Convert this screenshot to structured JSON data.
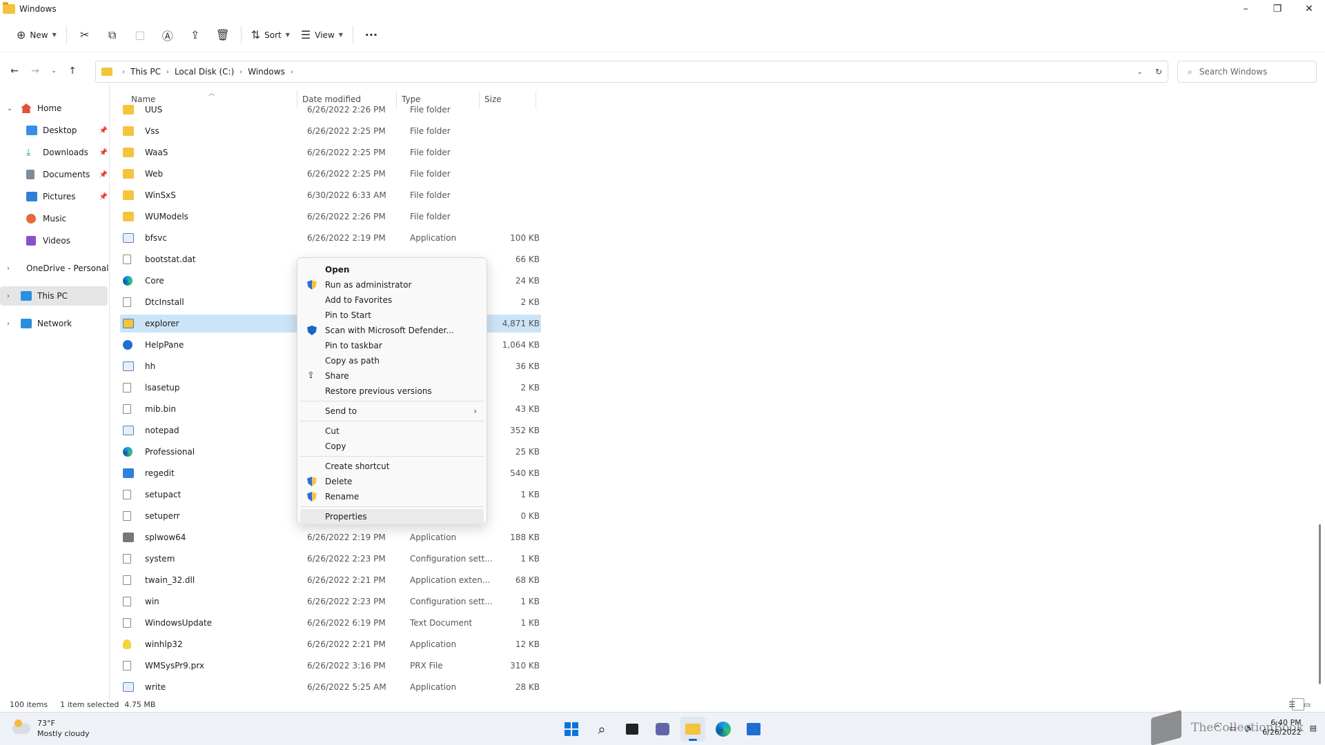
{
  "window": {
    "title": "Windows",
    "minimize": "–",
    "maximize": "❐",
    "close": "✕"
  },
  "toolbar": {
    "new_label": "New",
    "sort_label": "Sort",
    "view_label": "View",
    "more": "···"
  },
  "address": {
    "crumbs": [
      "This PC",
      "Local Disk (C:)",
      "Windows"
    ],
    "search_placeholder": "Search Windows"
  },
  "sidebar": {
    "items": [
      {
        "label": "Home",
        "icon": "home-icon",
        "color": "#e0533d"
      },
      {
        "label": "Desktop",
        "icon": "desktop-icon",
        "color": "#3a8ee6",
        "pinned": true
      },
      {
        "label": "Downloads",
        "icon": "download-icon",
        "color": "#1f9c5b",
        "pinned": true
      },
      {
        "label": "Documents",
        "icon": "documents-icon",
        "color": "#7f8b99",
        "pinned": true
      },
      {
        "label": "Pictures",
        "icon": "pictures-icon",
        "color": "#2f7fd8",
        "pinned": true
      },
      {
        "label": "Music",
        "icon": "music-icon",
        "color": "#e46a3a"
      },
      {
        "label": "Videos",
        "icon": "videos-icon",
        "color": "#8a4fd1"
      },
      {
        "label": "OneDrive - Personal",
        "icon": "onedrive-icon",
        "color": "#1e6fd1"
      },
      {
        "label": "This PC",
        "icon": "this-pc-icon",
        "color": "#2b8fe0"
      },
      {
        "label": "Network",
        "icon": "network-icon",
        "color": "#2b8fe0"
      }
    ]
  },
  "columns": {
    "name": "Name",
    "date": "Date modified",
    "type": "Type",
    "size": "Size"
  },
  "files": [
    {
      "name": "UUS",
      "date": "6/26/2022 2:26 PM",
      "type": "File folder",
      "size": "",
      "icon": "folder"
    },
    {
      "name": "Vss",
      "date": "6/26/2022 2:25 PM",
      "type": "File folder",
      "size": "",
      "icon": "folder"
    },
    {
      "name": "WaaS",
      "date": "6/26/2022 2:25 PM",
      "type": "File folder",
      "size": "",
      "icon": "folder"
    },
    {
      "name": "Web",
      "date": "6/26/2022 2:25 PM",
      "type": "File folder",
      "size": "",
      "icon": "folder"
    },
    {
      "name": "WinSxS",
      "date": "6/30/2022 6:33 AM",
      "type": "File folder",
      "size": "",
      "icon": "folder"
    },
    {
      "name": "WUModels",
      "date": "6/26/2022 2:26 PM",
      "type": "File folder",
      "size": "",
      "icon": "folder"
    },
    {
      "name": "bfsvc",
      "date": "6/26/2022 2:19 PM",
      "type": "Application",
      "size": "100 KB",
      "icon": "app"
    },
    {
      "name": "bootstat.dat",
      "date": "",
      "type": "",
      "size": "66 KB",
      "icon": "doc"
    },
    {
      "name": "Core",
      "date": "",
      "type": "",
      "size": "24 KB",
      "icon": "edge"
    },
    {
      "name": "DtcInstall",
      "date": "",
      "type": "",
      "size": "2 KB",
      "icon": "doc"
    },
    {
      "name": "explorer",
      "date": "",
      "type": "",
      "size": "4,871 KB",
      "icon": "explorer",
      "selected": true
    },
    {
      "name": "HelpPane",
      "date": "",
      "type": "",
      "size": "1,064 KB",
      "icon": "help"
    },
    {
      "name": "hh",
      "date": "",
      "type": "",
      "size": "36 KB",
      "icon": "app"
    },
    {
      "name": "lsasetup",
      "date": "",
      "type": "",
      "size": "2 KB",
      "icon": "doc"
    },
    {
      "name": "mib.bin",
      "date": "",
      "type": "",
      "size": "43 KB",
      "icon": "doc"
    },
    {
      "name": "notepad",
      "date": "",
      "type": "",
      "size": "352 KB",
      "icon": "app"
    },
    {
      "name": "Professional",
      "date": "",
      "type": "",
      "size": "25 KB",
      "icon": "edge"
    },
    {
      "name": "regedit",
      "date": "",
      "type": "",
      "size": "540 KB",
      "icon": "reg"
    },
    {
      "name": "setupact",
      "date": "",
      "type": "",
      "size": "1 KB",
      "icon": "doc"
    },
    {
      "name": "setuperr",
      "date": "",
      "type": "",
      "size": "0 KB",
      "icon": "doc"
    },
    {
      "name": "splwow64",
      "date": "6/26/2022 2:19 PM",
      "type": "Application",
      "size": "188 KB",
      "icon": "print"
    },
    {
      "name": "system",
      "date": "6/26/2022 2:23 PM",
      "type": "Configuration sett...",
      "size": "1 KB",
      "icon": "doc"
    },
    {
      "name": "twain_32.dll",
      "date": "6/26/2022 2:21 PM",
      "type": "Application exten...",
      "size": "68 KB",
      "icon": "doc"
    },
    {
      "name": "win",
      "date": "6/26/2022 2:23 PM",
      "type": "Configuration sett...",
      "size": "1 KB",
      "icon": "doc"
    },
    {
      "name": "WindowsUpdate",
      "date": "6/26/2022 6:19 PM",
      "type": "Text Document",
      "size": "1 KB",
      "icon": "doc"
    },
    {
      "name": "winhlp32",
      "date": "6/26/2022 2:21 PM",
      "type": "Application",
      "size": "12 KB",
      "icon": "bulb"
    },
    {
      "name": "WMSysPr9.prx",
      "date": "6/26/2022 3:16 PM",
      "type": "PRX File",
      "size": "310 KB",
      "icon": "doc"
    },
    {
      "name": "write",
      "date": "6/26/2022 5:25 AM",
      "type": "Application",
      "size": "28 KB",
      "icon": "app"
    }
  ],
  "context_menu": [
    {
      "label": "Open",
      "bold": true
    },
    {
      "label": "Run as administrator",
      "icon": "shield-icon"
    },
    {
      "label": "Add to Favorites"
    },
    {
      "label": "Pin to Start"
    },
    {
      "label": "Scan with Microsoft Defender...",
      "icon": "defender-icon"
    },
    {
      "label": "Pin to taskbar"
    },
    {
      "label": "Copy as path"
    },
    {
      "label": "Share",
      "icon": "share-icon"
    },
    {
      "label": "Restore previous versions"
    },
    {
      "sep": true
    },
    {
      "label": "Send to",
      "submenu": true
    },
    {
      "sep": true
    },
    {
      "label": "Cut"
    },
    {
      "label": "Copy"
    },
    {
      "sep": true
    },
    {
      "label": "Create shortcut"
    },
    {
      "label": "Delete",
      "icon": "shield-icon"
    },
    {
      "label": "Rename",
      "icon": "shield-icon"
    },
    {
      "sep": true
    },
    {
      "label": "Properties",
      "hover": true
    }
  ],
  "status": {
    "count": "100 items",
    "selected": "1 item selected",
    "size": "4.75 MB"
  },
  "taskbar": {
    "weather_temp": "73°F",
    "weather_desc": "Mostly cloudy",
    "time": "6:40 PM",
    "date": "6/26/2022",
    "watermark": "TheCollectionBook"
  }
}
